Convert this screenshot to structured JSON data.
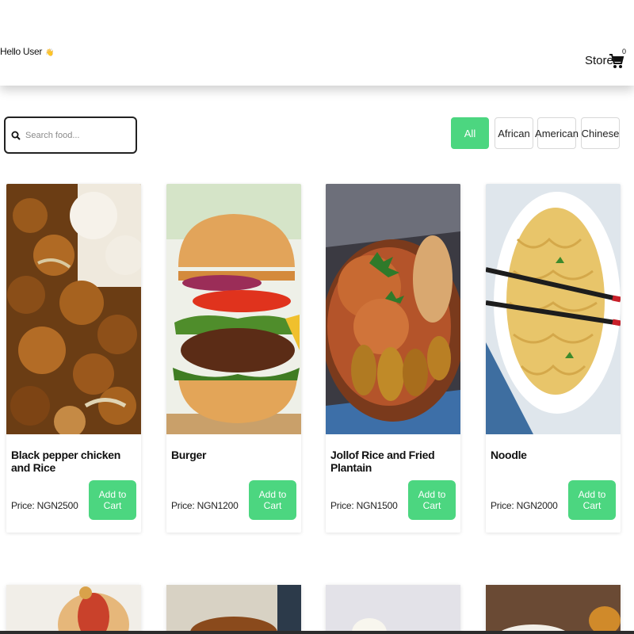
{
  "header": {
    "greeting": "Hello User",
    "greeting_emoji": "👋",
    "store_label": "Store",
    "cart_count": "0"
  },
  "search": {
    "placeholder": "Search food..."
  },
  "filters": [
    "All",
    "African",
    "American",
    "Chinese"
  ],
  "active_filter": "All",
  "accent_color": "#4cd680",
  "products": [
    {
      "name": "Black pepper chicken and Rice",
      "price": "Price: NGN2500",
      "button": "Add to Cart"
    },
    {
      "name": "Burger",
      "price": "Price: NGN1200",
      "button": "Add to Cart"
    },
    {
      "name": "Jollof Rice and Fried Plantain",
      "price": "Price: NGN1500",
      "button": "Add to Cart"
    },
    {
      "name": "Noodle",
      "price": "Price: NGN2000",
      "button": "Add to Cart"
    }
  ],
  "icons": [
    "search-icon",
    "cart-icon"
  ]
}
